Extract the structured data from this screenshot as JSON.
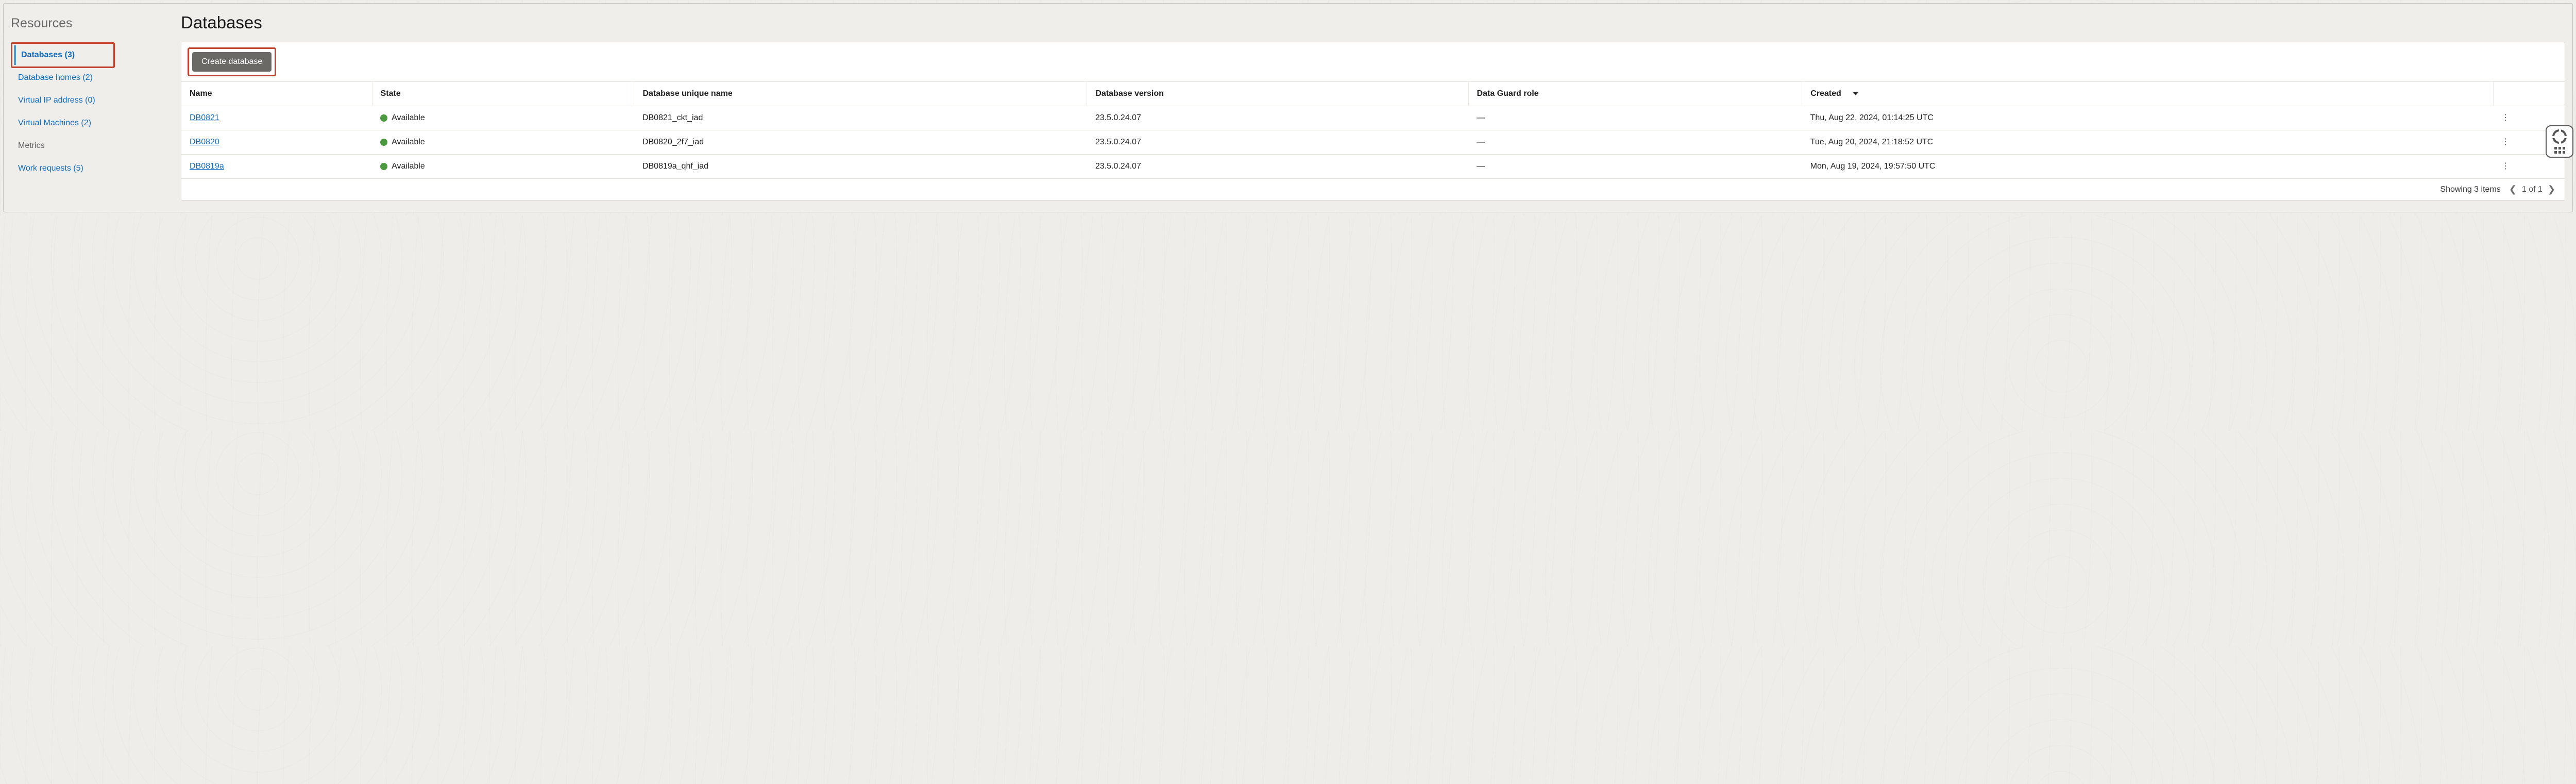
{
  "sidebar": {
    "title": "Resources",
    "items": [
      {
        "label": "Databases (3)",
        "active": true,
        "highlight": true
      },
      {
        "label": "Database homes (2)"
      },
      {
        "label": "Virtual IP address (0)"
      },
      {
        "label": "Virtual Machines (2)"
      },
      {
        "label": "Metrics",
        "muted": true
      },
      {
        "label": "Work requests (5)"
      }
    ]
  },
  "main": {
    "title": "Databases",
    "create_label": "Create database",
    "columns": {
      "name": "Name",
      "state": "State",
      "unique": "Database unique name",
      "version": "Database version",
      "role": "Data Guard role",
      "created": "Created"
    },
    "status_available": "Available",
    "empty_role": "—",
    "rows": [
      {
        "name": "DB0821",
        "state": "Available",
        "unique": "DB0821_ckt_iad",
        "version": "23.5.0.24.07",
        "role": "—",
        "created": "Thu, Aug 22, 2024, 01:14:25 UTC"
      },
      {
        "name": "DB0820",
        "state": "Available",
        "unique": "DB0820_2f7_iad",
        "version": "23.5.0.24.07",
        "role": "—",
        "created": "Tue, Aug 20, 2024, 21:18:52 UTC"
      },
      {
        "name": "DB0819a",
        "state": "Available",
        "unique": "DB0819a_qhf_iad",
        "version": "23.5.0.24.07",
        "role": "—",
        "created": "Mon, Aug 19, 2024, 19:57:50 UTC"
      }
    ],
    "footer": {
      "summary": "Showing 3 items",
      "page": "1 of 1"
    }
  },
  "status_color": "#4b9a3f"
}
